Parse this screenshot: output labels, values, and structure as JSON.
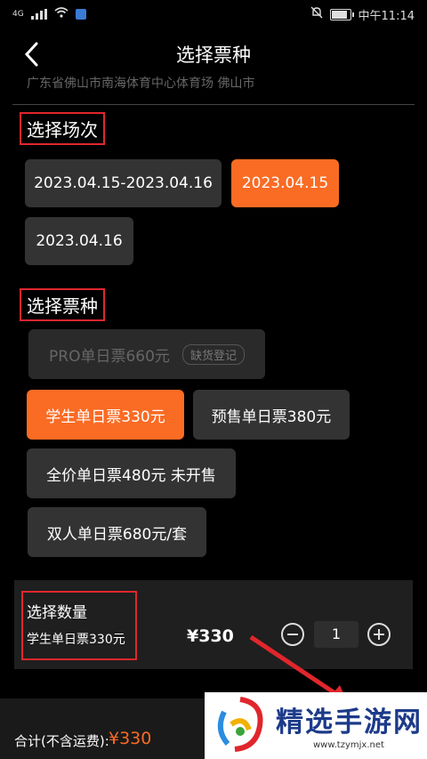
{
  "status": {
    "carrier": "4G",
    "time": "中午11:14"
  },
  "nav": {
    "title": "选择票种"
  },
  "venue": "广东省佛山市南海体育中心体育场 佛山市",
  "session": {
    "title": "选择场次",
    "options": [
      {
        "label": "2023.04.15-2023.04.16",
        "state": "normal"
      },
      {
        "label": "2023.04.15",
        "state": "selected"
      },
      {
        "label": "2023.04.16",
        "state": "normal"
      }
    ]
  },
  "ticket": {
    "title": "选择票种",
    "options": [
      {
        "label": "PRO单日票660元",
        "tag": "缺货登记",
        "state": "disabled"
      },
      {
        "label": "学生单日票330元",
        "state": "selected"
      },
      {
        "label": "预售单日票380元",
        "state": "normal"
      },
      {
        "label": "全价单日票480元 未开售",
        "state": "normal"
      },
      {
        "label": "双人单日票680元/套",
        "state": "normal"
      }
    ]
  },
  "quantity": {
    "title": "选择数量",
    "ticket_name": "学生单日票330元",
    "price": "¥330",
    "value": "1"
  },
  "footer": {
    "total_label": "合计(不含运费):",
    "total_value": "¥330"
  },
  "watermark": {
    "name": "精选手游网",
    "url": "www.tzymjx.net"
  },
  "colors": {
    "accent": "#fa6b24",
    "highlight_box": "#e0262c",
    "background": "#000000"
  }
}
